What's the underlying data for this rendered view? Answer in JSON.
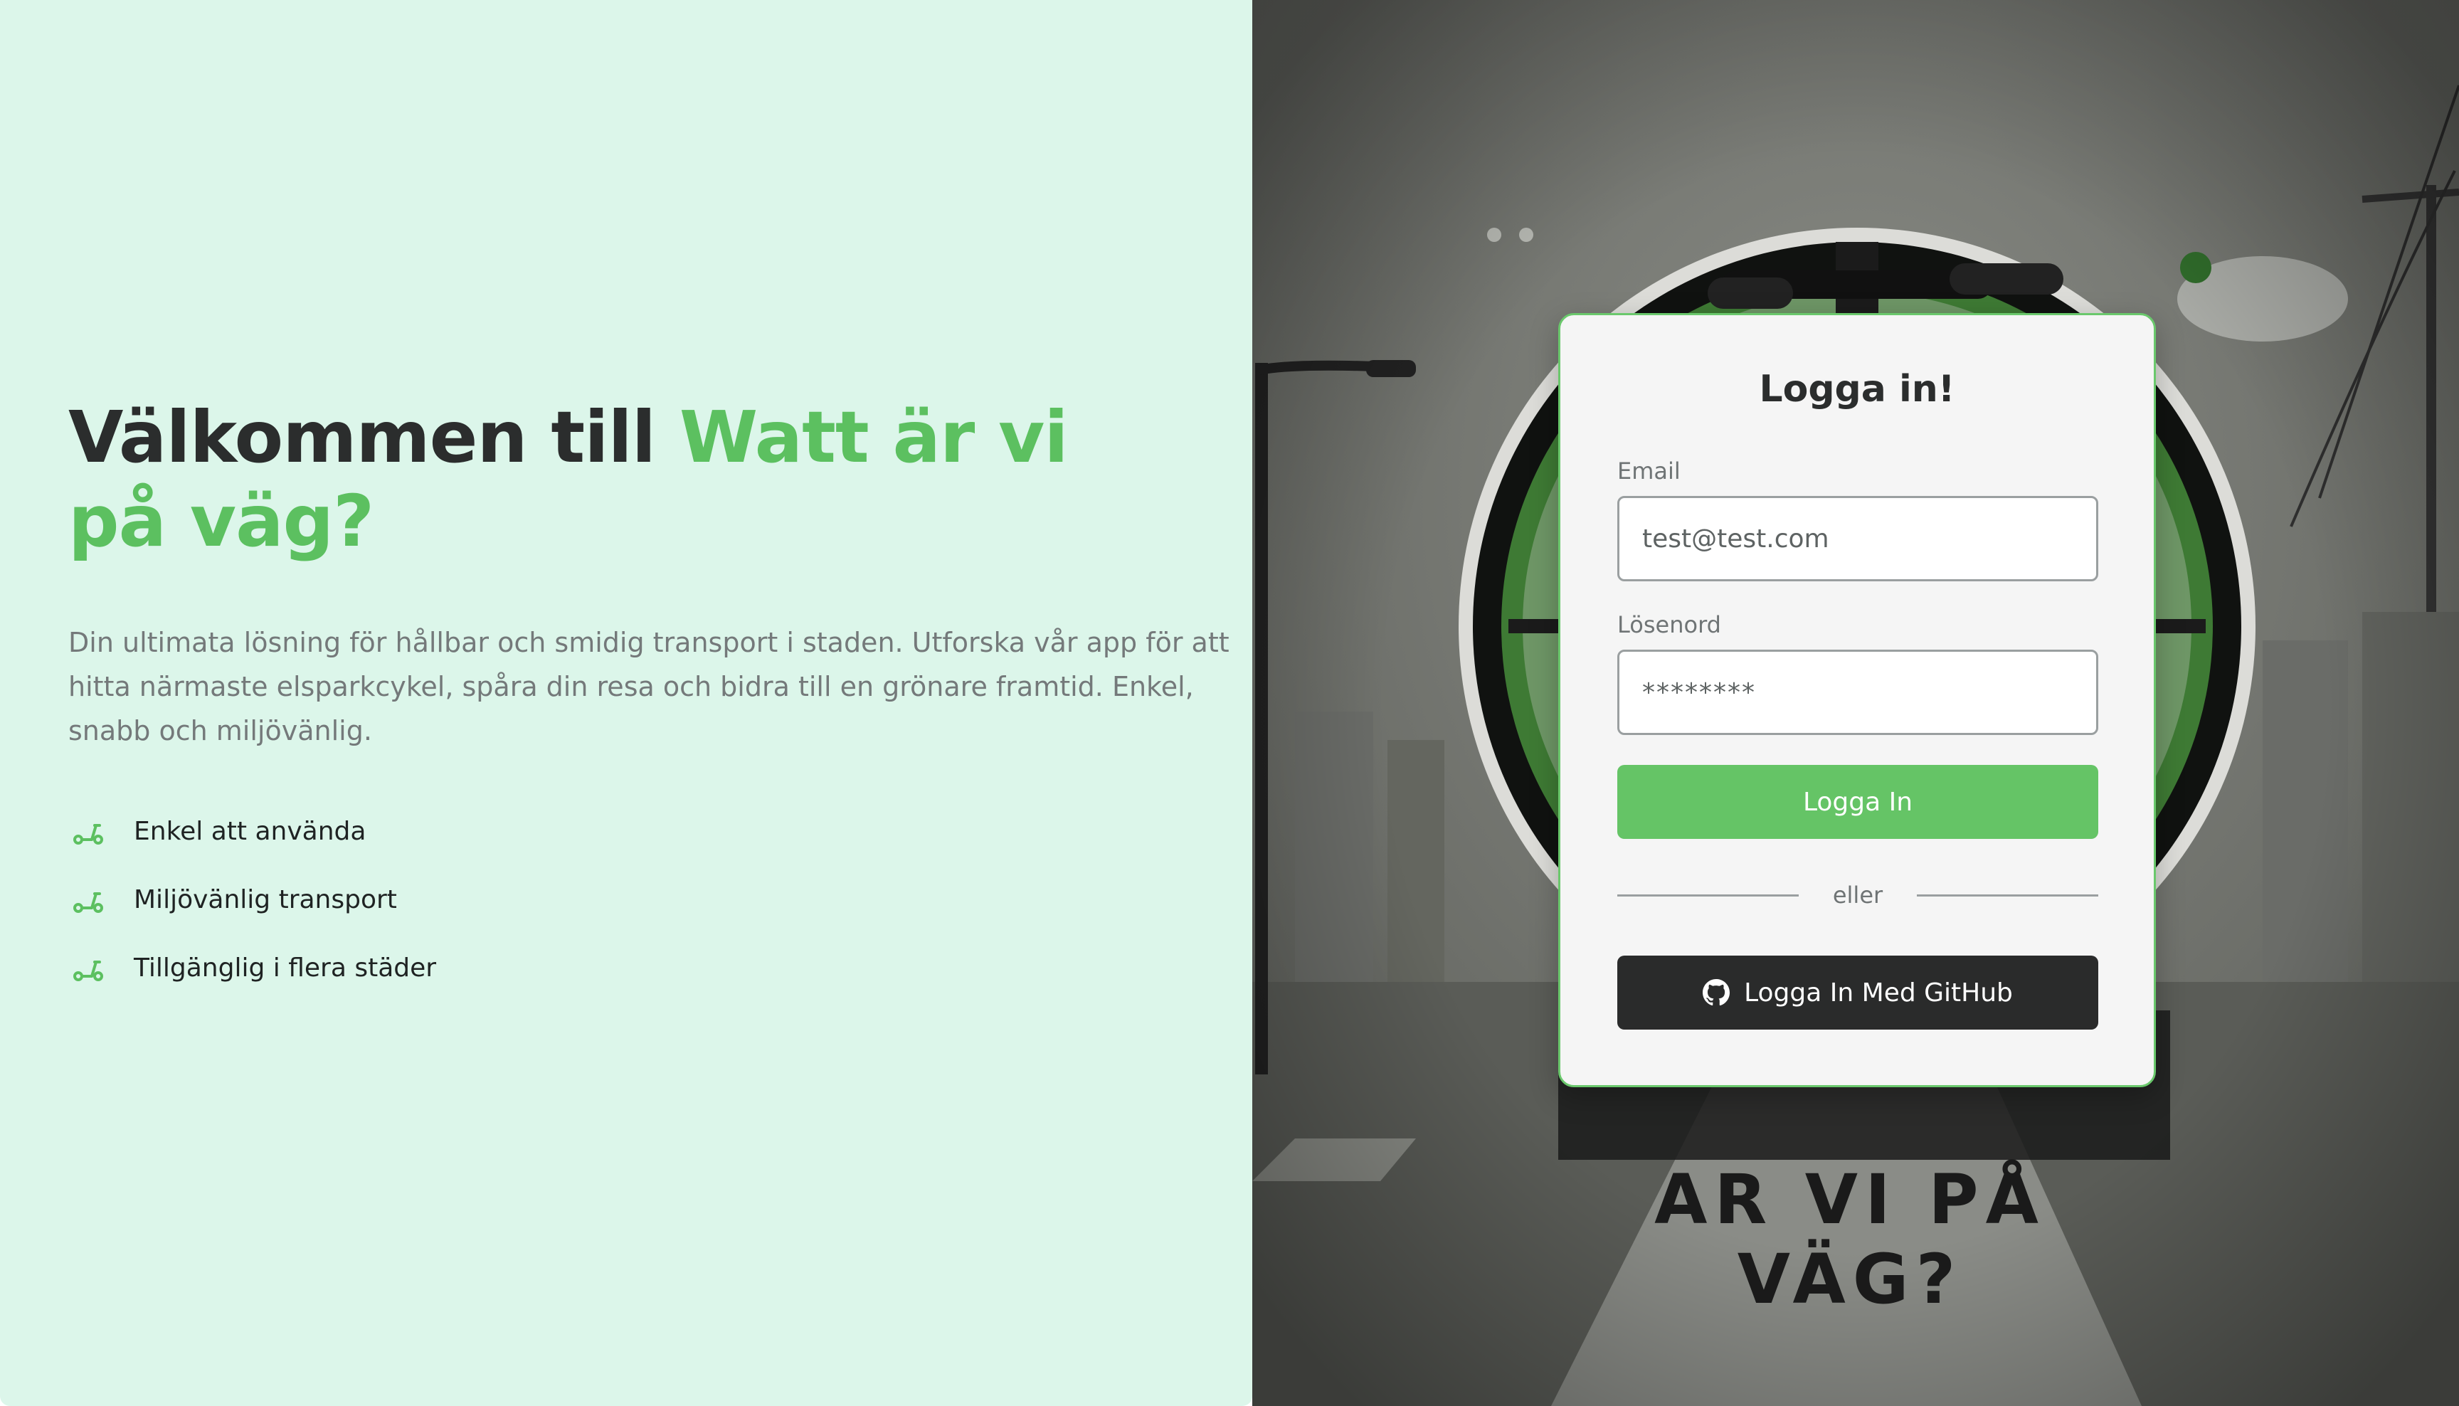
{
  "hero": {
    "title_prefix": "Välkommen till ",
    "title_accent": "Watt är vi på väg?",
    "description": "Din ultimata lösning för hållbar och smidig transport i staden. Utforska vår app för att hitta närmaste elsparkcykel, spåra din resa och bidra till en grönare framtid. Enkel, snabb och miljövänlig."
  },
  "features": [
    {
      "icon": "scooter-icon",
      "label": "Enkel att använda"
    },
    {
      "icon": "scooter-icon",
      "label": "Miljövänlig transport"
    },
    {
      "icon": "scooter-icon",
      "label": "Tillgänglig i flera städer"
    }
  ],
  "login": {
    "title": "Logga in!",
    "email_label": "Email",
    "email_value": "test@test.com",
    "password_label": "Lösenord",
    "password_value": "********",
    "submit_label": "Logga In",
    "divider_text": "eller",
    "github_label": "Logga In Med GitHub",
    "github_icon": "github-icon"
  },
  "background": {
    "logo_subtitle": "AR VI PÅ VÄG?"
  },
  "colors": {
    "accent": "#5cc060",
    "left_bg": "#dcf6ea",
    "button_green": "#65c466",
    "button_dark": "#2a2b2b",
    "heading": "#2b2d2d"
  }
}
